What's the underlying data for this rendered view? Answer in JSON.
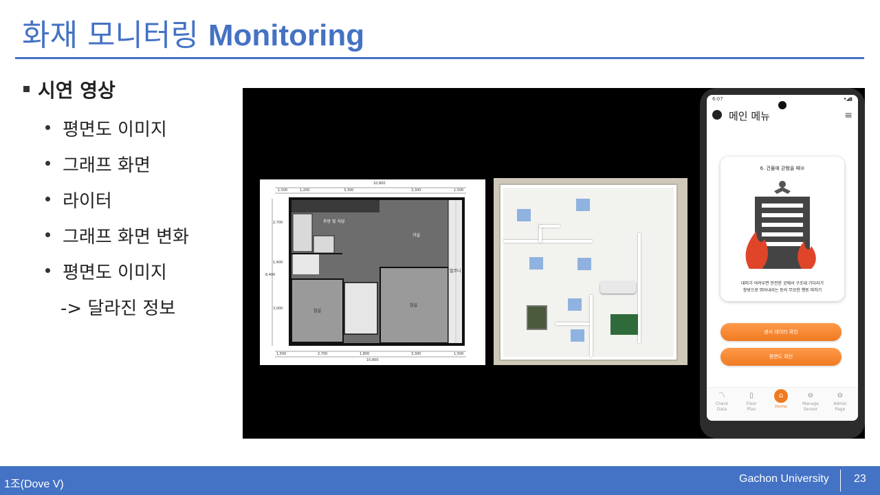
{
  "slide": {
    "title_ko": "화재 모니터링",
    "title_en": "Monitoring",
    "main_bullet": "시연 영상",
    "sub_bullets": [
      "평면도 이미지",
      "그래프 화면",
      "라이터",
      "그래프 화면 변화",
      "평면도 이미지"
    ],
    "sub_note": "-> 달라진 정보"
  },
  "floorplan": {
    "top_total": "10,800",
    "top_dims": [
      "1,500",
      "1,200",
      "3,300",
      "3,300",
      "1,500"
    ],
    "bottom_dims": [
      "1,500",
      "2,700",
      "1,800",
      "3,300",
      "1,500"
    ],
    "bottom_total": "10,800",
    "left_dims": [
      "2,700",
      "1,400",
      "3,000"
    ],
    "left_total": "8,400",
    "rooms": [
      "주방 및 식당",
      "거실",
      "발코니",
      "침실",
      "침실"
    ]
  },
  "phone": {
    "status_time": "6:07",
    "app_title": "메인 메뉴",
    "card_title": "6. 건물에 갇혔을 때②",
    "card_desc_1": "대피가 어려우면 안전한 곳에서 구조대 기다리기",
    "card_desc_2": "창밖으로 뛰어내리는 등의 무모한 행동 피하기",
    "btn_sensor": "센서 데이터 확인",
    "btn_plan": "평면도 확인",
    "nav": [
      {
        "icon": "chart-icon",
        "label1": "Check",
        "label2": "Data"
      },
      {
        "icon": "floor-plan-icon",
        "label1": "Floor",
        "label2": "Plan"
      },
      {
        "icon": "home-icon",
        "label1": "Home",
        "label2": ""
      },
      {
        "icon": "manage-sensor-icon",
        "label1": "Manage",
        "label2": "Sensor"
      },
      {
        "icon": "admin-icon",
        "label1": "Admin",
        "label2": "Page"
      }
    ]
  },
  "footer": {
    "left": "1조(Dove V)",
    "right": "Gachon  University",
    "page": "23"
  },
  "colors": {
    "accent": "#4472c4",
    "orange": "#f07a22",
    "fire": "#e0452a"
  }
}
